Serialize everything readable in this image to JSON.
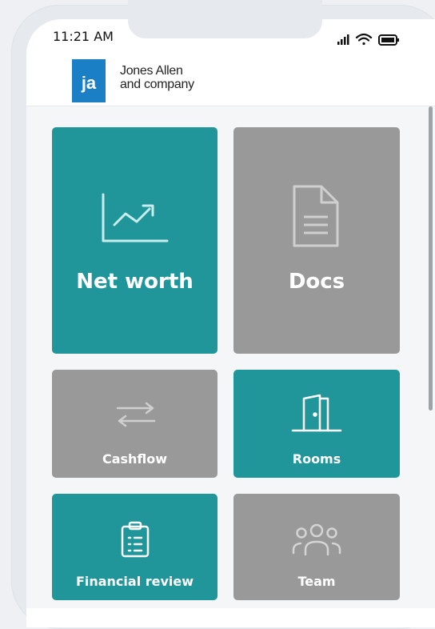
{
  "status_bar": {
    "time": "11:21 AM"
  },
  "header": {
    "logo_initials": "ja",
    "company_line1": "Jones Allen",
    "company_line2": "and company"
  },
  "tiles": [
    {
      "label": "Net worth",
      "icon": "chart-line-up-icon",
      "color": "#20969b"
    },
    {
      "label": "Docs",
      "icon": "document-icon",
      "color": "#999999"
    },
    {
      "label": "Cashflow",
      "icon": "arrows-exchange-icon",
      "color": "#999999"
    },
    {
      "label": "Rooms",
      "icon": "door-icon",
      "color": "#20969b"
    },
    {
      "label": "Financial review",
      "icon": "clipboard-icon",
      "color": "#20969b"
    },
    {
      "label": "Team",
      "icon": "team-icon",
      "color": "#999999"
    }
  ]
}
